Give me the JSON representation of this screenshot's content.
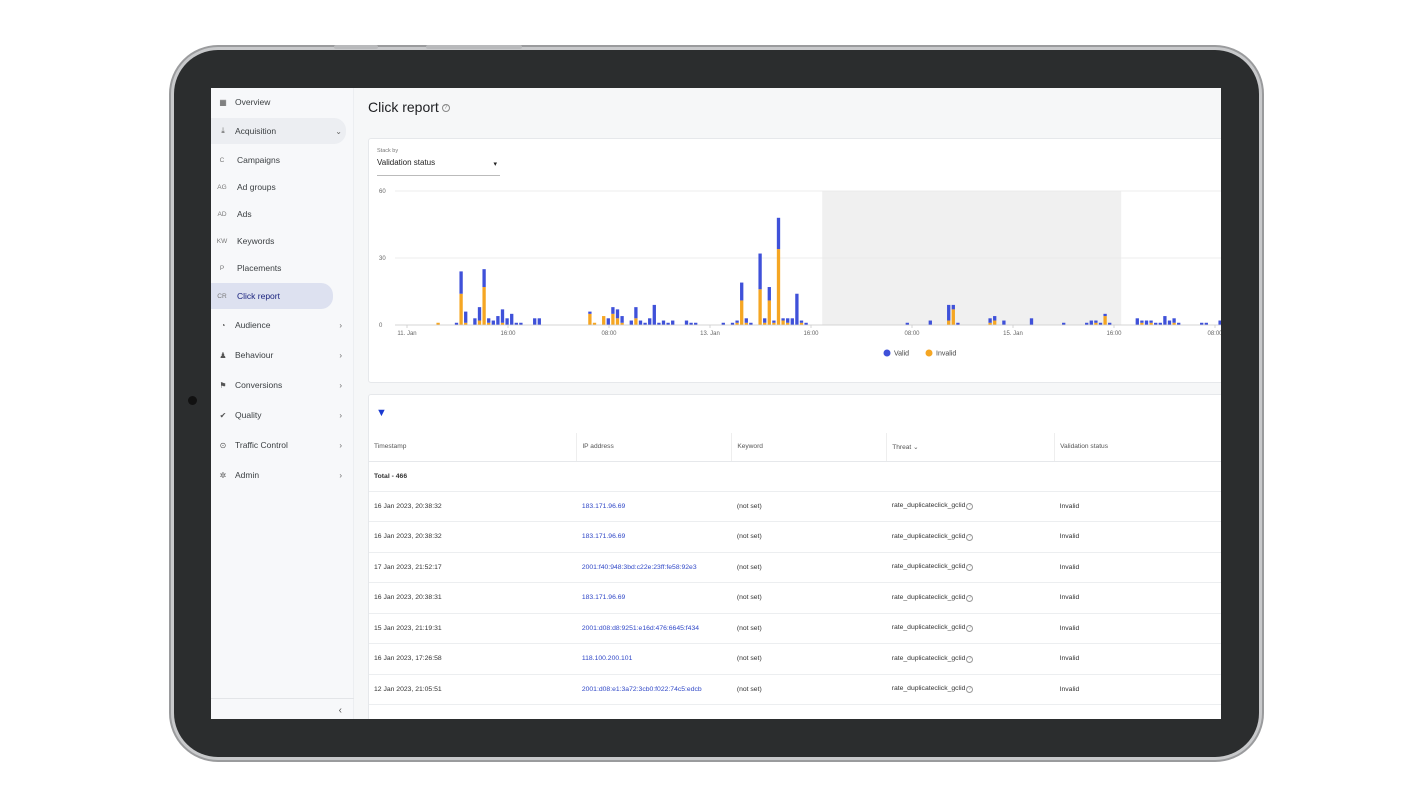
{
  "sidebar": {
    "items": [
      {
        "icon": "grid-icon",
        "glyph": "▦",
        "label": "Overview"
      },
      {
        "icon": "download-icon",
        "glyph": "⤓",
        "label": "Acquisition"
      },
      {
        "abbr": "C",
        "label": "Campaigns"
      },
      {
        "abbr": "AG",
        "label": "Ad groups"
      },
      {
        "abbr": "AD",
        "label": "Ads"
      },
      {
        "abbr": "KW",
        "label": "Keywords"
      },
      {
        "abbr": "P",
        "label": "Placements"
      },
      {
        "abbr": "CR",
        "label": "Click report"
      },
      {
        "icon": "audience-icon",
        "glyph": "◔",
        "label": "Audience"
      },
      {
        "icon": "behaviour-icon",
        "glyph": "♟",
        "label": "Behaviour"
      },
      {
        "icon": "flag-icon",
        "glyph": "⚑",
        "label": "Conversions"
      },
      {
        "icon": "check-circle-icon",
        "glyph": "✔",
        "label": "Quality"
      },
      {
        "icon": "target-icon",
        "glyph": "⊙",
        "label": "Traffic Control"
      },
      {
        "icon": "gear-icon",
        "glyph": "✲",
        "label": "Admin"
      }
    ],
    "collapse_glyph": "‹"
  },
  "header": {
    "title": "Click report"
  },
  "stack": {
    "label": "Stack by",
    "value": "Validation status"
  },
  "chart_data": {
    "type": "bar",
    "stacked": true,
    "ylim": [
      0,
      60
    ],
    "yticks": [
      "60",
      "30",
      "0"
    ],
    "xticks": [
      "11. Jan",
      "16:00",
      "08:00",
      "13. Jan",
      "16:00",
      "08:00",
      "15. Jan",
      "16:00",
      "08:00"
    ],
    "legend": {
      "position": "bottom",
      "items": [
        {
          "name": "Valid",
          "color": "#3f51d9"
        },
        {
          "name": "Invalid",
          "color": "#f5a623"
        }
      ]
    },
    "series": [
      {
        "name": "Valid",
        "values": [
          0,
          0,
          0,
          0,
          0,
          0,
          0,
          0,
          0,
          0,
          0,
          0,
          1,
          10,
          5,
          0,
          3,
          6,
          8,
          2,
          2,
          4,
          6,
          3,
          5,
          1,
          1,
          0,
          0,
          3,
          3,
          0,
          0,
          0,
          0,
          0,
          0,
          0,
          0,
          0,
          0,
          1,
          0,
          0,
          0,
          3,
          3,
          4,
          3,
          0,
          2,
          5,
          2,
          1,
          3,
          9,
          1,
          2,
          1,
          2,
          0,
          0,
          2,
          1,
          1,
          0,
          0,
          0,
          0,
          0,
          1,
          0,
          1,
          1,
          8,
          2,
          1,
          0,
          16,
          2,
          6,
          1,
          14,
          1,
          2,
          3,
          14,
          1,
          1,
          0,
          0,
          0,
          0,
          0,
          0,
          0,
          0,
          0,
          0,
          0,
          0,
          0,
          0,
          0,
          0,
          0,
          0,
          0,
          0,
          0,
          1,
          0,
          0,
          0,
          0,
          2,
          0,
          0,
          0,
          7,
          2,
          1,
          0,
          0,
          0,
          0,
          0,
          0,
          2,
          2,
          0,
          2,
          0,
          0,
          0,
          0,
          0,
          3,
          0,
          0,
          0,
          0,
          0,
          0,
          1,
          0,
          0,
          0,
          0,
          1,
          2,
          1,
          1,
          1,
          1,
          0,
          0,
          0,
          0,
          0,
          3,
          1,
          2,
          1,
          1,
          1,
          4,
          2,
          2,
          1,
          0,
          0,
          0,
          0,
          1,
          1,
          0,
          0,
          2,
          1
        ]
      },
      {
        "name": "Invalid",
        "values": [
          0,
          0,
          0,
          0,
          0,
          0,
          0,
          0,
          1,
          0,
          0,
          0,
          0,
          14,
          1,
          0,
          0,
          2,
          17,
          1,
          0,
          0,
          1,
          0,
          0,
          0,
          0,
          0,
          0,
          0,
          0,
          0,
          0,
          0,
          0,
          0,
          0,
          0,
          0,
          0,
          0,
          5,
          1,
          0,
          4,
          0,
          5,
          3,
          1,
          0,
          0,
          3,
          0,
          0,
          0,
          0,
          0,
          0,
          0,
          0,
          0,
          0,
          0,
          0,
          0,
          0,
          0,
          0,
          0,
          0,
          0,
          0,
          0,
          1,
          11,
          1,
          0,
          0,
          16,
          1,
          11,
          1,
          34,
          2,
          1,
          0,
          0,
          1,
          0,
          0,
          0,
          0,
          0,
          0,
          0,
          0,
          0,
          0,
          0,
          0,
          0,
          0,
          0,
          0,
          0,
          0,
          0,
          0,
          0,
          0,
          0,
          0,
          0,
          0,
          0,
          0,
          0,
          0,
          0,
          2,
          7,
          0,
          0,
          0,
          0,
          0,
          0,
          0,
          1,
          2,
          0,
          0,
          0,
          0,
          0,
          0,
          0,
          0,
          0,
          0,
          0,
          0,
          0,
          0,
          0,
          0,
          0,
          0,
          0,
          0,
          0,
          1,
          0,
          4,
          0,
          0,
          0,
          0,
          0,
          0,
          0,
          1,
          0,
          1,
          0,
          0,
          0,
          0,
          1,
          0,
          0,
          0,
          0,
          0,
          0,
          0,
          0,
          0,
          0,
          0,
          0,
          0
        ]
      }
    ],
    "highlight_range": [
      92,
      157
    ]
  },
  "table": {
    "columns": [
      "Timestamp",
      "IP address",
      "Keyword",
      "Threat ⌄",
      "Validation status"
    ],
    "total": "Total - 466",
    "rows": [
      {
        "timestamp": "16 Jan 2023, 20:38:32",
        "ip": "183.171.96.69",
        "keyword": "(not set)",
        "threat": "rate_duplicateclick_gclid",
        "status": "Invalid"
      },
      {
        "timestamp": "16 Jan 2023, 20:38:32",
        "ip": "183.171.96.69",
        "keyword": "(not set)",
        "threat": "rate_duplicateclick_gclid",
        "status": "Invalid"
      },
      {
        "timestamp": "17 Jan 2023, 21:52:17",
        "ip": "2001:f40:948:3bd:c22e:23ff:fe58:92e3",
        "keyword": "(not set)",
        "threat": "rate_duplicateclick_gclid",
        "status": "Invalid"
      },
      {
        "timestamp": "16 Jan 2023, 20:38:31",
        "ip": "183.171.96.69",
        "keyword": "(not set)",
        "threat": "rate_duplicateclick_gclid",
        "status": "Invalid"
      },
      {
        "timestamp": "15 Jan 2023, 21:19:31",
        "ip": "2001:d08:d8:9251:e16d:476:6645:f434",
        "keyword": "(not set)",
        "threat": "rate_duplicateclick_gclid",
        "status": "Invalid"
      },
      {
        "timestamp": "16 Jan 2023, 17:26:58",
        "ip": "118.100.200.101",
        "keyword": "(not set)",
        "threat": "rate_duplicateclick_gclid",
        "status": "Invalid"
      },
      {
        "timestamp": "12 Jan 2023, 21:05:51",
        "ip": "2001:d08:e1:3a72:3cb0:f022:74c5:edcb",
        "keyword": "(not set)",
        "threat": "rate_duplicateclick_gclid",
        "status": "Invalid"
      }
    ]
  }
}
